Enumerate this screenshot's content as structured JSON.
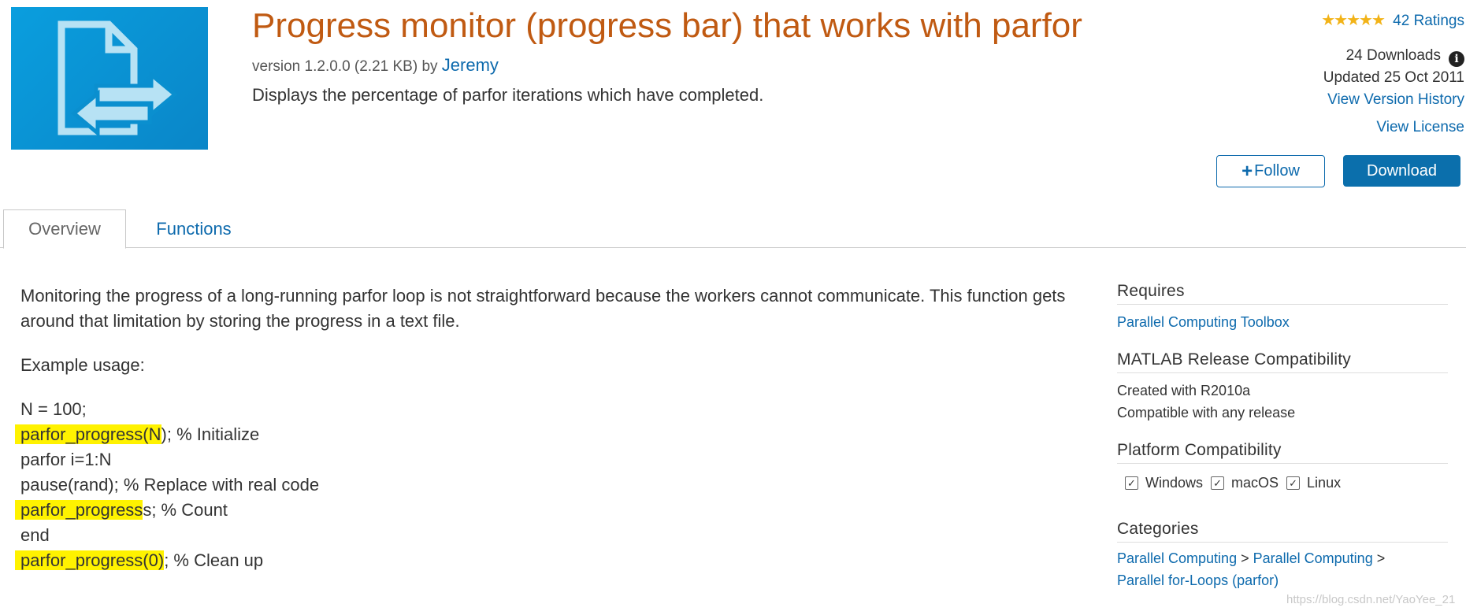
{
  "header": {
    "thumbnail_icon": "file-exchange-icon",
    "title": "Progress monitor (progress bar) that works with parfor",
    "version_text": "version 1.2.0.0 (2.21 KB) by",
    "author": "Jeremy",
    "summary": "Displays the percentage of parfor iterations which have completed."
  },
  "meta": {
    "rating_stars": "★★★★★",
    "ratings_label": "42 Ratings",
    "downloads": "24 Downloads",
    "updated": "Updated 25 Oct 2011",
    "view_version_history": "View Version History",
    "view_license": "View License"
  },
  "actions": {
    "follow_plus": "+",
    "follow_label": "Follow",
    "download_label": "Download"
  },
  "tabs": [
    {
      "label": "Overview",
      "active": true
    },
    {
      "label": "Functions",
      "active": false
    }
  ],
  "overview": {
    "description": "Monitoring the progress of a long-running parfor loop is not straightforward because the workers cannot communicate. This function gets around that limitation by storing the progress in a text file.",
    "example_label": "Example usage:",
    "code": [
      {
        "highlight": "",
        "rest": "N = 100;"
      },
      {
        "highlight": "parfor_progress(N",
        "rest": "); % Initialize"
      },
      {
        "highlight": "",
        "rest": "parfor i=1:N"
      },
      {
        "highlight": "",
        "rest": "pause(rand); % Replace with real code"
      },
      {
        "highlight": "parfor_progress",
        "rest": "s; % Count"
      },
      {
        "highlight": "",
        "rest": "end"
      },
      {
        "highlight": "parfor_progress(0)",
        "rest": "; % Clean up"
      }
    ]
  },
  "sidebar": {
    "requires": {
      "heading": "Requires",
      "item": "Parallel Computing Toolbox"
    },
    "release": {
      "heading": "MATLAB Release Compatibility",
      "created": "Created with R2010a",
      "compatible": "Compatible with any release"
    },
    "platform": {
      "heading": "Platform Compatibility",
      "items": [
        {
          "label": "Windows",
          "checked": true
        },
        {
          "label": "macOS",
          "checked": true
        },
        {
          "label": "Linux",
          "checked": true
        }
      ]
    },
    "categories": {
      "heading": "Categories",
      "items": [
        "Parallel Computing",
        "Parallel Computing",
        "Parallel for-Loops (parfor)"
      ],
      "separator": ">"
    }
  },
  "watermark": "https://blog.csdn.net/YaoYee_21",
  "colors": {
    "title": "#c05a12",
    "link": "#0d6aad",
    "download_button": "#0b6fac",
    "highlight": "#fff200",
    "stars": "#f2b318",
    "thumbnail": "#0a9ede"
  }
}
